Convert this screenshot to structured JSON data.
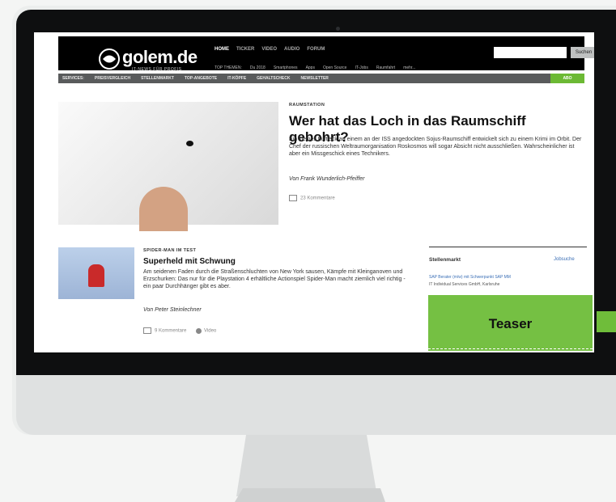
{
  "header": {
    "logo_text": "golem.de",
    "logo_tagline": "IT-NEWS FÜR PROFIS",
    "nav": [
      "HOME",
      "TICKER",
      "VIDEO",
      "AUDIO",
      "FORUM"
    ],
    "topics_label": "TOP THEMEN:",
    "topics": [
      "Du 2018",
      "Smartphones",
      "Apps",
      "Open Source",
      "IT-Jobs",
      "Raumfahrt",
      "mehr..."
    ],
    "search_placeholder": "",
    "search_button": "Suchen"
  },
  "secondary_nav": {
    "items": [
      "SERVICES:",
      "PREISVERGLEICH",
      "STELLENMARKT",
      "TOP-ANGEBOTE",
      "IT-KÖPFE",
      "GEHALTSCHECK",
      "NEWSLETTER"
    ],
    "abo": "ABO"
  },
  "article1": {
    "kicker": "RAUMSTATION",
    "title": "Wer hat das Loch in das Raumschiff gebohrt?",
    "body": "Ein kleines Luftleck an einem an der ISS angedockten Sojus-Raumschiff entwickelt sich zu einem Krimi im Orbit. Der Chef der russischen Weltraumorganisation Roskosmos will sogar Absicht nicht ausschließen. Wahrscheinlicher ist aber ein Missgeschick eines Technikers.",
    "author": "Von Frank Wunderlich-Pfeiffer",
    "comments": "23 Kommentare"
  },
  "article2": {
    "kicker": "SPIDER-MAN IM TEST",
    "title": "Superheld mit Schwung",
    "body": "Am seidenen Faden durch die Straßenschluchten von New York sausen, Kämpfe mit Kleinganoven und Erzschurken: Das nur für die Playstation 4 erhältliche Actionspiel Spider-Man macht ziemlich viel richtig - ein paar Durchhänger gibt es aber.",
    "author": "Von Peter Steinlechner",
    "comments": "9 Kommentare",
    "video": "Video"
  },
  "sidebar": {
    "title": "Stellenmarkt",
    "link": "Jobsuche",
    "job1": "SAP Berater (m/w) mit Schwerpunkt SAP MM",
    "job2": "IT Individual Services GmbH, Karlsruhe"
  },
  "teaser": {
    "label": "Teaser",
    "color": "#75c043"
  }
}
